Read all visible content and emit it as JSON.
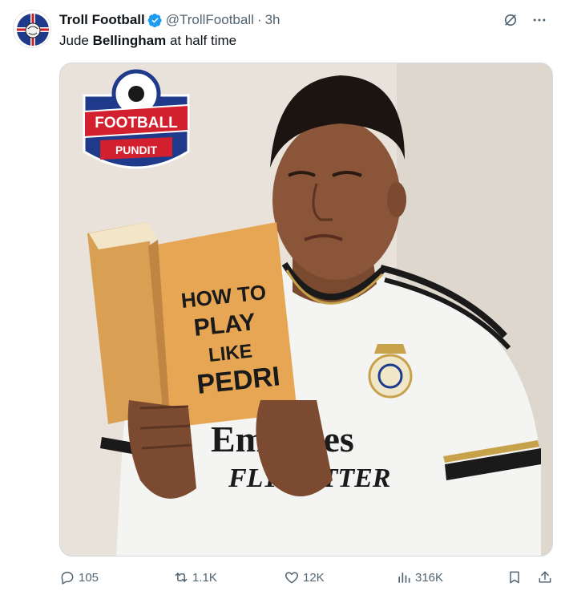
{
  "author": {
    "name": "Troll Football",
    "handle": "@TrollFootball",
    "separator": "·",
    "time": "3h",
    "verified": true,
    "avatar_top_text": "SOCCER",
    "avatar_bottom_text": "FOOTBALL"
  },
  "tweet": {
    "text_part1": "Jude ",
    "text_bold": "Bellingham",
    "text_part2": " at half time"
  },
  "media": {
    "logo_line1": "FOOTBALL",
    "logo_line2": "PUNDIT",
    "book_line1": "HOW TO",
    "book_line2": "PLAY",
    "book_line3": "LIKE",
    "book_line4": "PEDRI",
    "shirt_text1": "Emirates",
    "shirt_text2": "FLY BETTER"
  },
  "actions": {
    "replies": "105",
    "retweets": "1.1K",
    "likes": "12K",
    "views": "316K"
  },
  "colors": {
    "accent": "#1d9bf0",
    "muted": "#536471",
    "text": "#0f1419"
  }
}
